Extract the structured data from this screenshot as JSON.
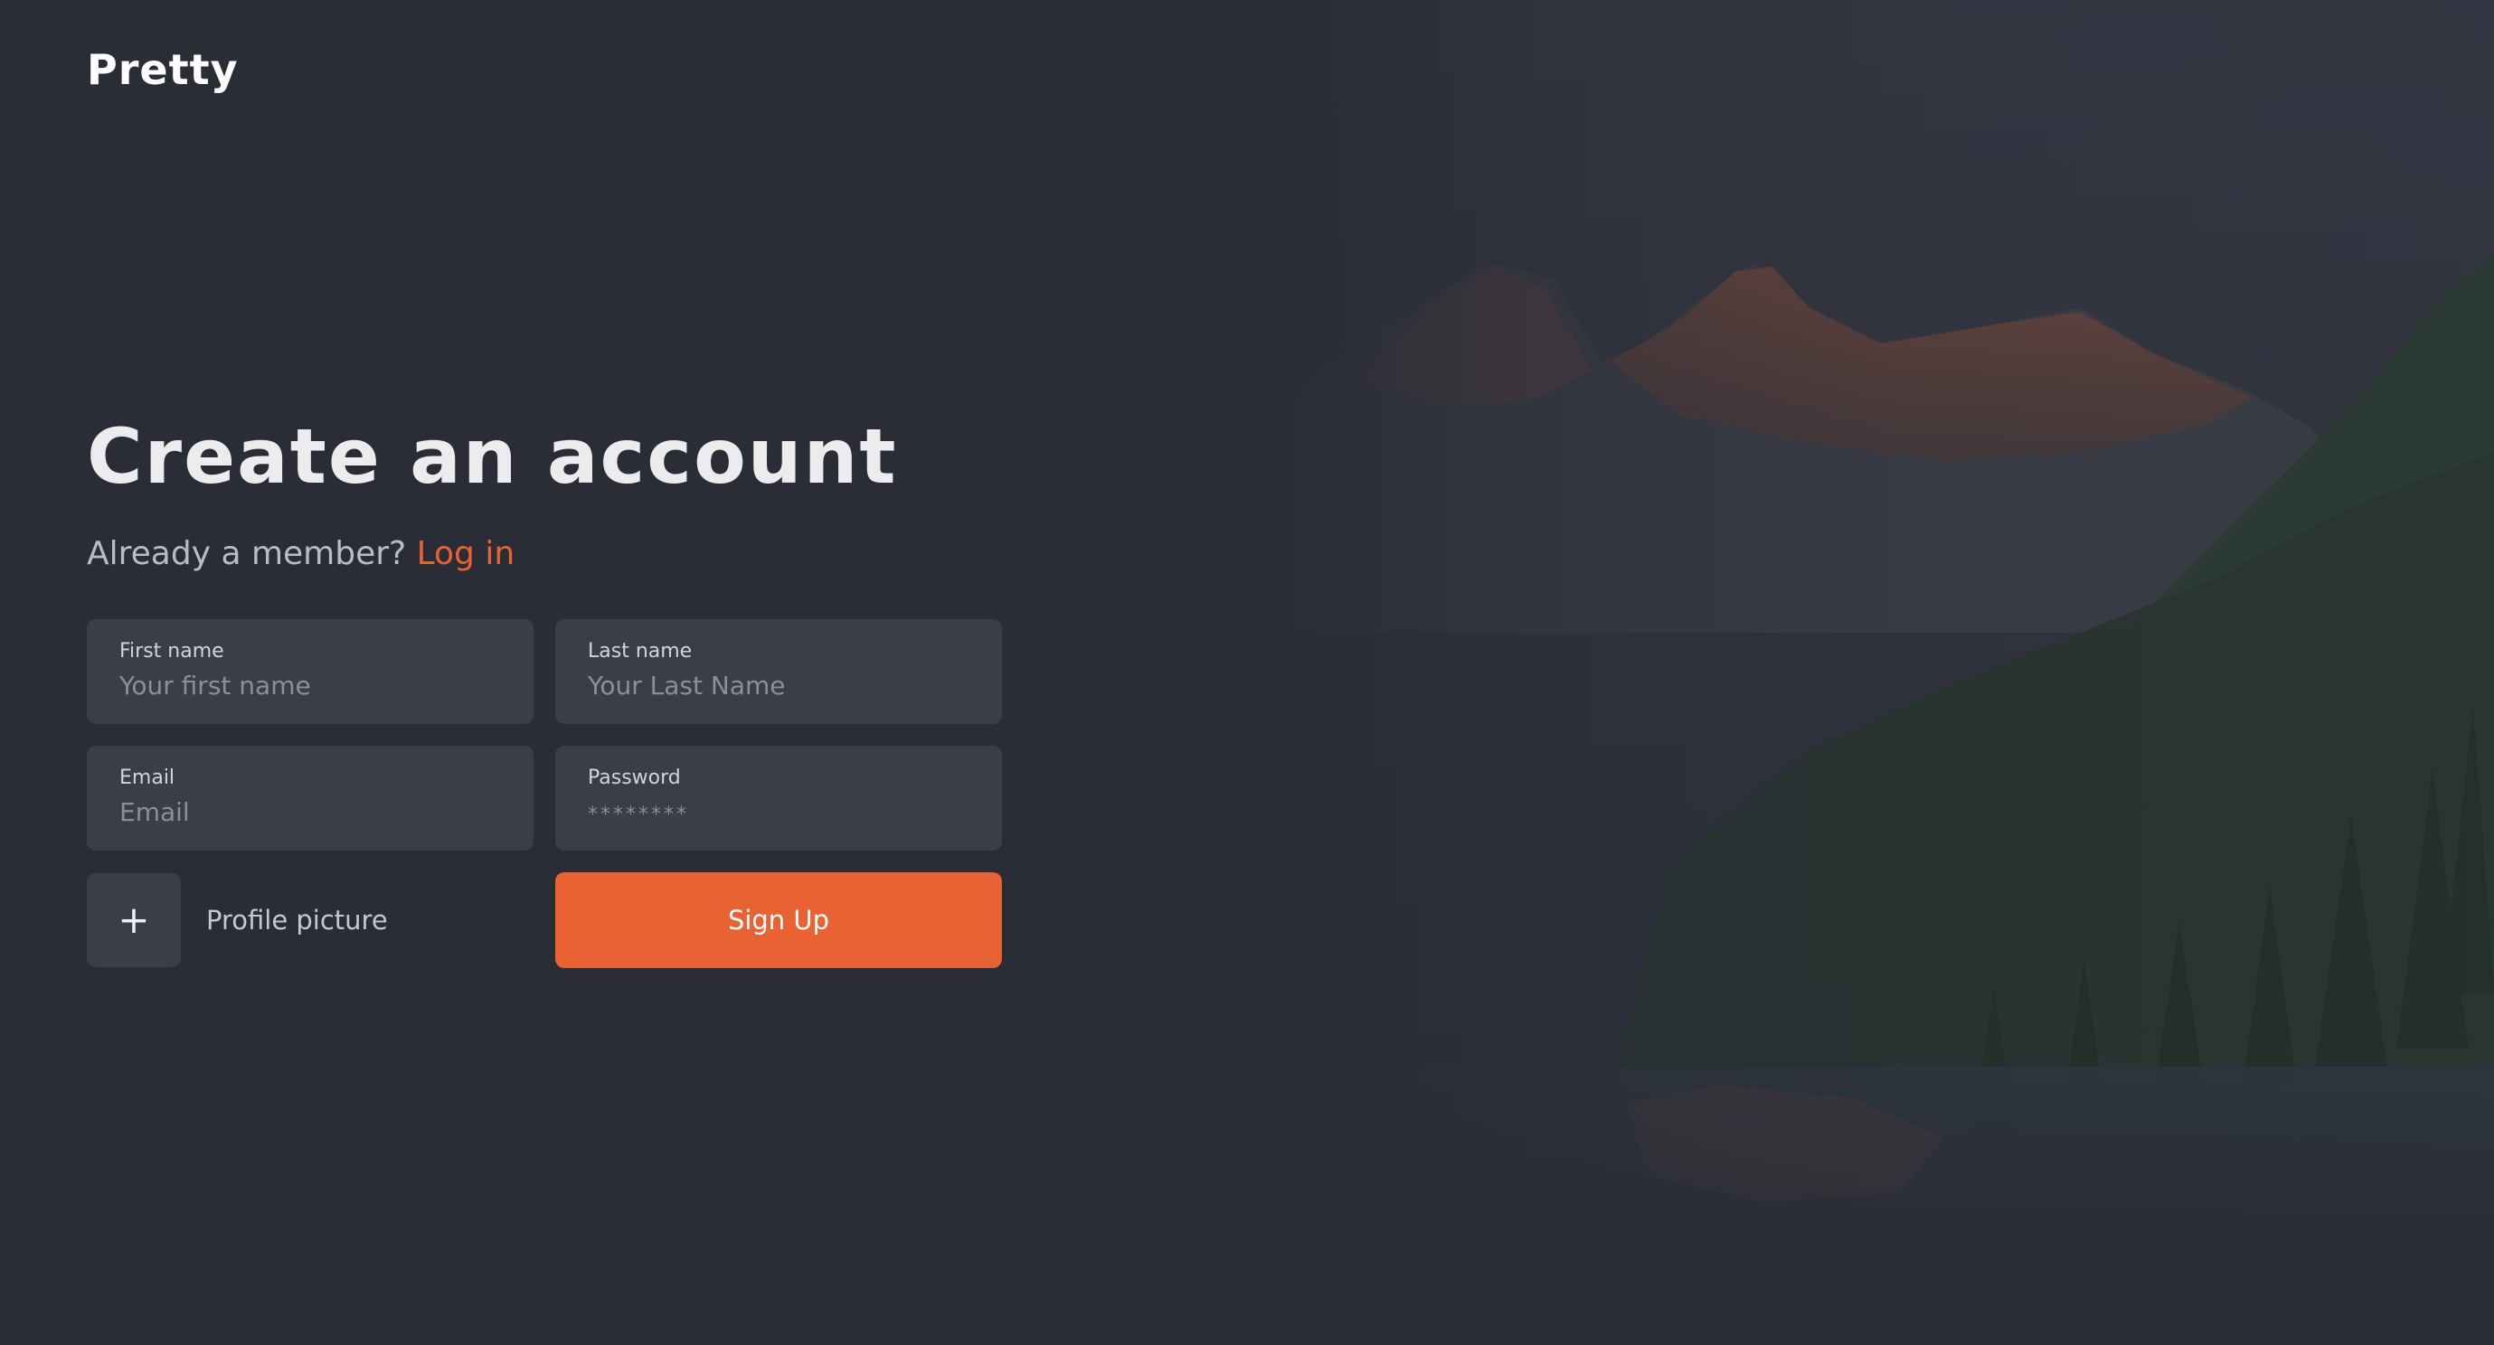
{
  "brand": {
    "logo_text": "Pretty"
  },
  "colors": {
    "background": "#2a2c36",
    "field_bg": "#3b3d48",
    "accent": "#e86233"
  },
  "header": {
    "title": "Create an account",
    "member_prompt": "Already a member?",
    "login_link": "Log in"
  },
  "form": {
    "first_name": {
      "label": "First name",
      "placeholder": "Your first name"
    },
    "last_name": {
      "label": "Last name",
      "placeholder": "Your Last Name"
    },
    "email": {
      "label": "Email",
      "placeholder": "Email"
    },
    "password": {
      "label": "Password",
      "placeholder": "********"
    },
    "profile_picture": {
      "button_icon": "+",
      "label": "Profile picture"
    },
    "submit_label": "Sign Up"
  },
  "background": {
    "icon": "mountain-lake-forest-image"
  }
}
